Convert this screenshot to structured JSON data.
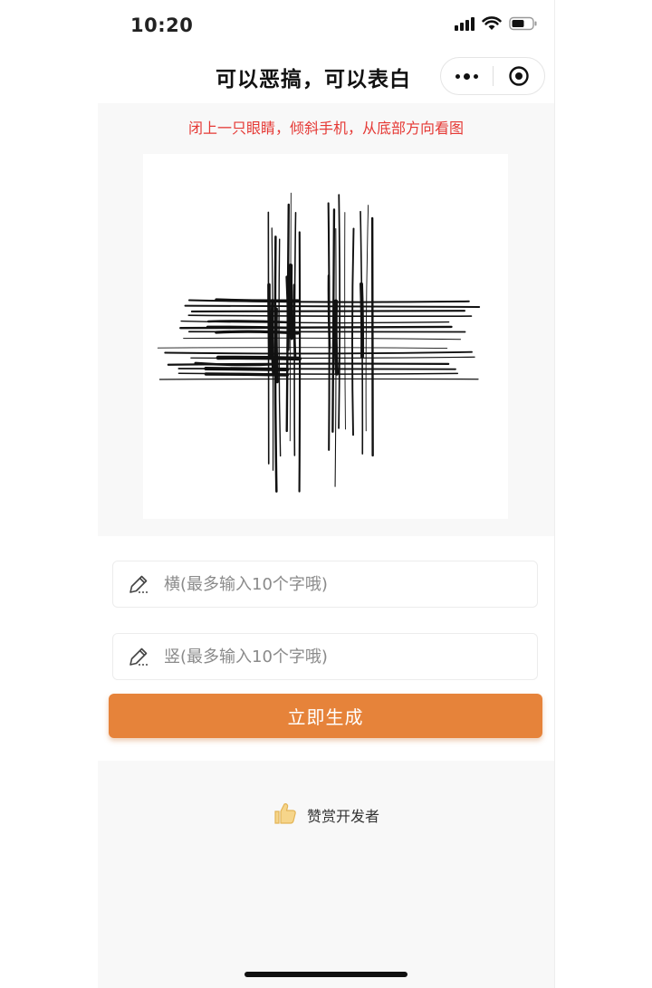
{
  "status_bar": {
    "time": "10:20",
    "icons": [
      "signal-icon",
      "wifi-icon",
      "battery-icon"
    ]
  },
  "nav": {
    "title": "可以恶搞，可以表白",
    "more_icon": "more-dots-icon",
    "close_icon": "target-close-icon"
  },
  "hint": {
    "text": "闭上一只眼睛，倾斜手机，从底部方向看图",
    "color": "#e53935"
  },
  "art": {
    "icon": "stretched-text-artwork"
  },
  "form": {
    "horizontal": {
      "value": "",
      "placeholder": "横(最多输入10个字哦)"
    },
    "vertical": {
      "value": "",
      "placeholder": "竖(最多输入10个字哦)"
    },
    "generate_label": "立即生成",
    "accent_color": "#e6833a"
  },
  "appreciate": {
    "label": "赞赏开发者",
    "icon": "thumbs-up-icon"
  }
}
